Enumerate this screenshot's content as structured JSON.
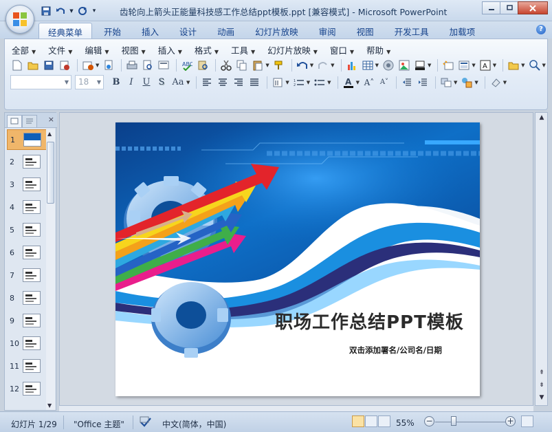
{
  "window": {
    "title": "齿轮向上箭头正能量科技感工作总结ppt模板.ppt [兼容模式] - Microsoft PowerPoint"
  },
  "ribbon": {
    "tabs": [
      "经典菜单",
      "开始",
      "插入",
      "设计",
      "动画",
      "幻灯片放映",
      "审阅",
      "视图",
      "开发工具",
      "加载项"
    ],
    "active_tab_index": 0,
    "menus": [
      "全部",
      "文件",
      "编辑",
      "视图",
      "插入",
      "格式",
      "工具",
      "幻灯片放映",
      "窗口",
      "帮助"
    ],
    "font_name": "",
    "font_size": "18"
  },
  "thumbnails": [
    "1",
    "2",
    "3",
    "4",
    "5",
    "6",
    "7",
    "8",
    "9",
    "10",
    "11",
    "12"
  ],
  "selected_slide": 1,
  "slide": {
    "title": "职场工作总结PPT模板",
    "subtitle": "双击添加署名/公司名/日期"
  },
  "status": {
    "slide_counter": "幻灯片 1/29",
    "theme": "\"Office 主题\"",
    "language": "中文(简体，中国)",
    "zoom": "55%"
  },
  "colors": {
    "accent_blue": "#0d5fb5",
    "selection_orange": "#f0b66a"
  }
}
